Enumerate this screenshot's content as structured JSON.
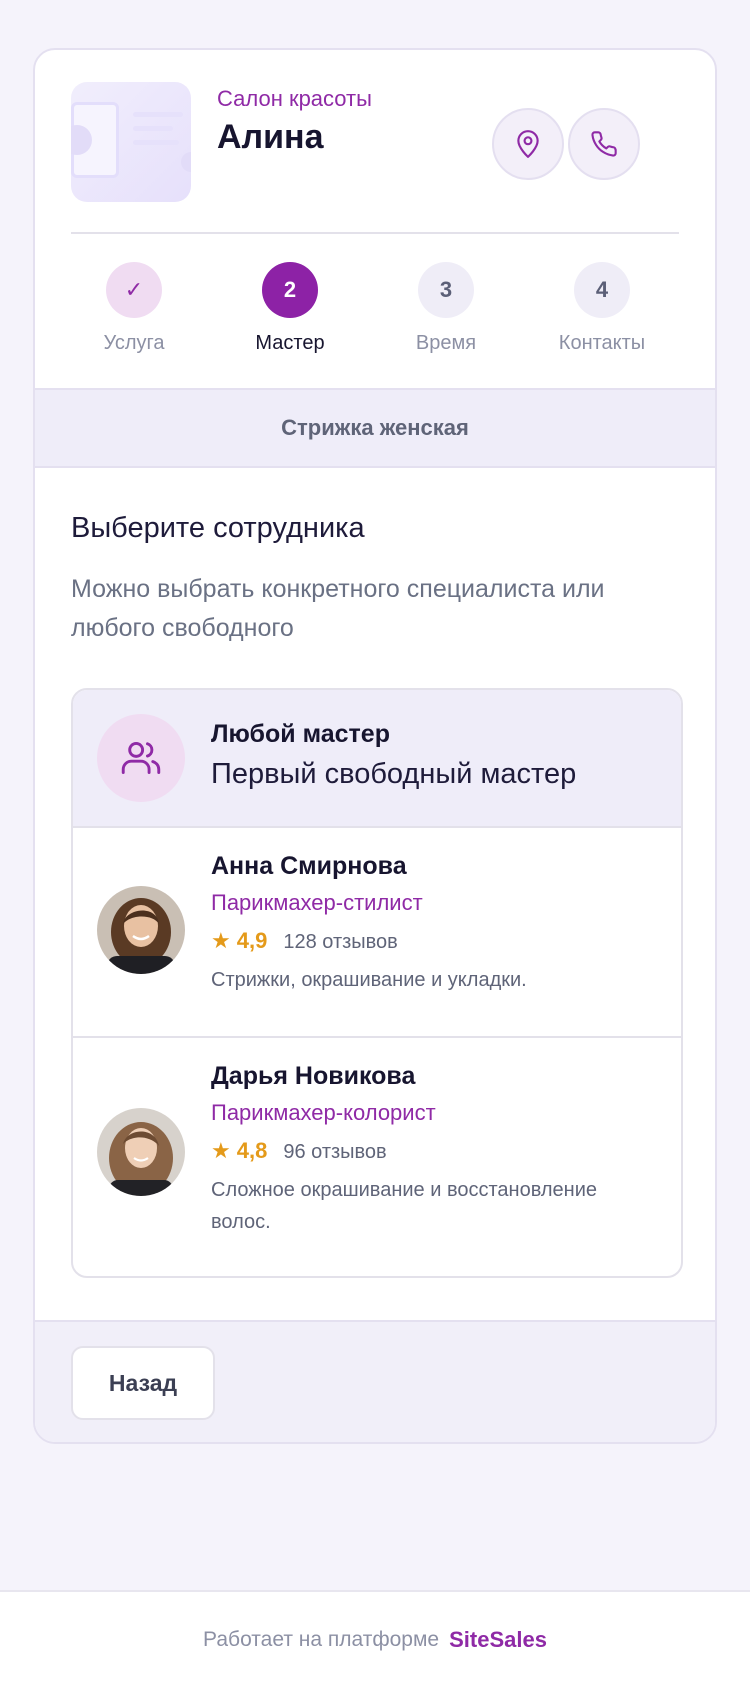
{
  "header": {
    "salon_type": "Салон красоты",
    "salon_name": "Алина",
    "location_icon": "map-pin-icon",
    "phone_icon": "phone-icon"
  },
  "steps": [
    {
      "label": "Услуга",
      "marker": "✓",
      "state": "done"
    },
    {
      "label": "Мастер",
      "marker": "2",
      "state": "active"
    },
    {
      "label": "Время",
      "marker": "3",
      "state": "pending"
    },
    {
      "label": "Контакты",
      "marker": "4",
      "state": "pending"
    }
  ],
  "selected_service": "Стрижка женская",
  "section": {
    "title": "Выберите сотрудника",
    "description": "Можно выбрать конкретного специалиста или любого свободного"
  },
  "any_master": {
    "title": "Любой мастер",
    "subtitle": "Первый свободный мастер",
    "icon": "users-icon"
  },
  "masters": [
    {
      "name": "Анна Смирнова",
      "role": "Парикмахер-стилист",
      "rating": "4,9",
      "reviews": "128 отзывов",
      "description": "Стрижки, окрашивание и укладки."
    },
    {
      "name": "Дарья Новикова",
      "role": "Парикмахер-колорист",
      "rating": "4,8",
      "reviews": "96 отзывов",
      "description": "Сложное окрашивание и восстановление волос."
    }
  ],
  "footer": {
    "back_label": "Назад"
  },
  "platform": {
    "prefix": "Работает на платформе",
    "brand": "SiteSales"
  },
  "colors": {
    "accent": "#8d22a6",
    "star": "#e49a1a",
    "page_bg": "#f5f3fb"
  }
}
